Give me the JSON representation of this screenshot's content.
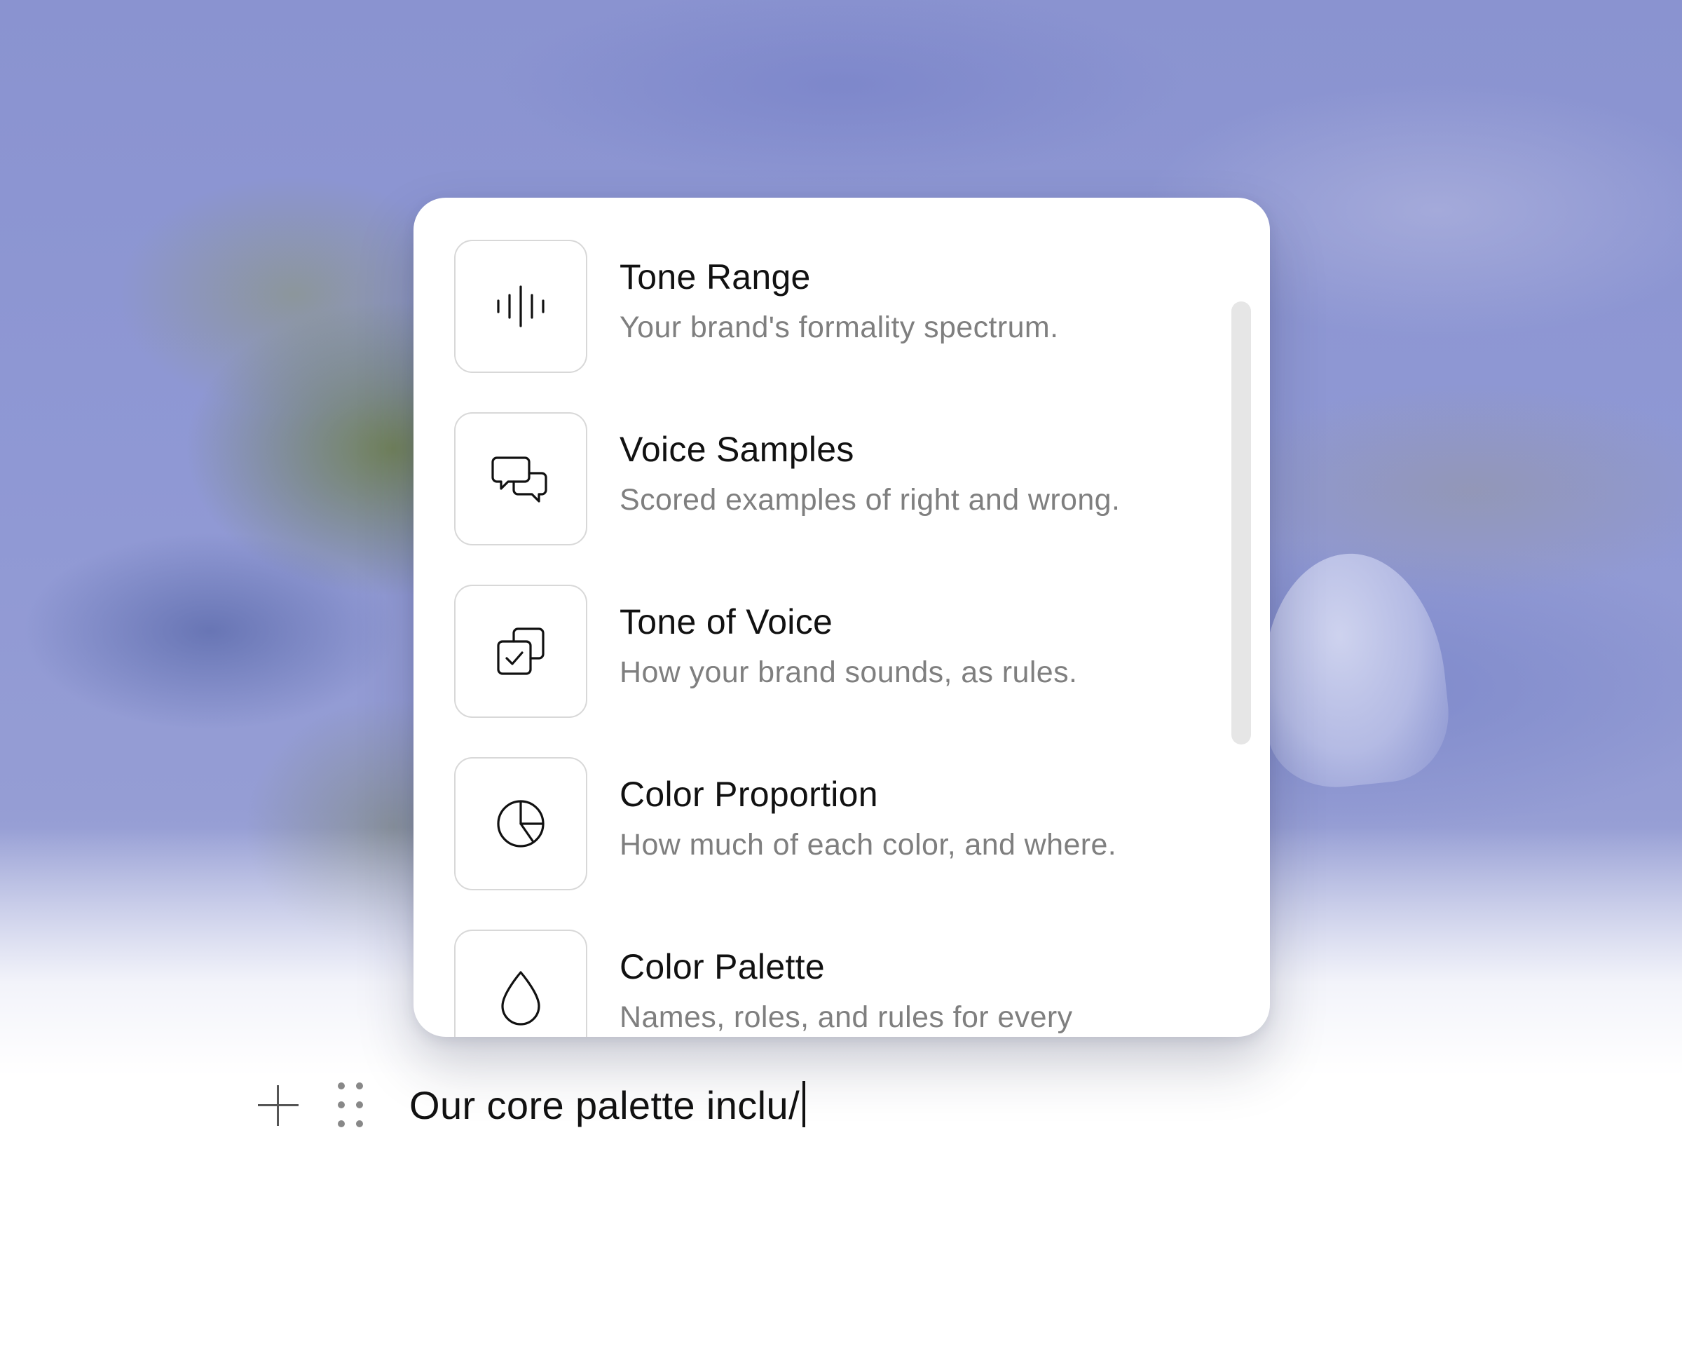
{
  "command_menu": {
    "items": [
      {
        "title": "Tone Range",
        "description": "Your brand's formality spectrum.",
        "icon": "audio-waveform-icon"
      },
      {
        "title": "Voice Samples",
        "description": "Scored examples of right and wrong.",
        "icon": "chat-bubbles-icon"
      },
      {
        "title": "Tone of Voice",
        "description": "How your brand sounds, as rules.",
        "icon": "checked-squares-icon"
      },
      {
        "title": "Color Proportion",
        "description": "How much of each color, and where.",
        "icon": "pie-chart-icon"
      },
      {
        "title": "Color Palette",
        "description": "Names, roles, and rules for every",
        "icon": "droplet-icon"
      }
    ]
  },
  "editor": {
    "line_text": "Our core palette inclu/"
  },
  "colors": {
    "menu_background": "#ffffff",
    "title_text": "#111111",
    "description_text": "#7f7f7f",
    "icon_border": "#d8d8d8",
    "scrollbar_thumb": "#e6e6e6"
  }
}
